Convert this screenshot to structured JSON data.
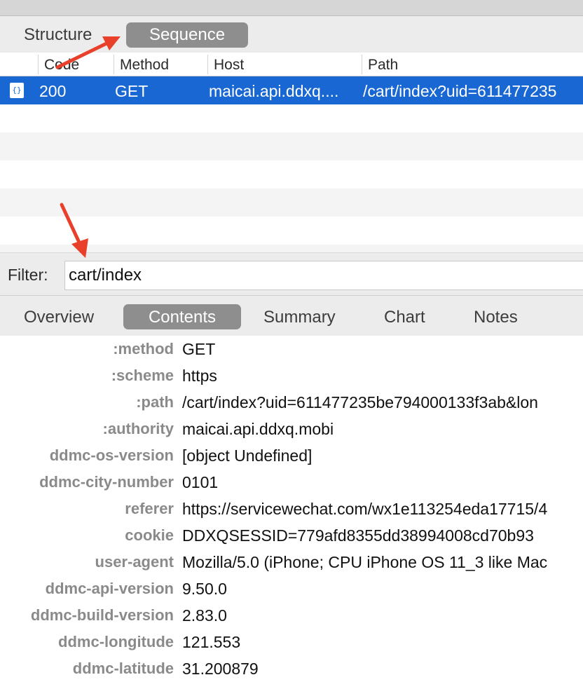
{
  "view_tabs": [
    "Structure",
    "Sequence"
  ],
  "columns": {
    "code": "Code",
    "method": "Method",
    "host": "Host",
    "path": "Path"
  },
  "selected_request": {
    "icon": "json-document-icon",
    "code": "200",
    "method": "GET",
    "host": "maicai.api.ddxq....",
    "path": "/cart/index?uid=611477235"
  },
  "filter": {
    "label": "Filter:",
    "value": "cart/index"
  },
  "detail_tabs": [
    "Overview",
    "Contents",
    "Summary",
    "Chart",
    "Notes"
  ],
  "headers": [
    {
      "key": ":method",
      "value": "GET"
    },
    {
      "key": ":scheme",
      "value": "https"
    },
    {
      "key": ":path",
      "value": "/cart/index?uid=611477235be794000133f3ab&lon"
    },
    {
      "key": ":authority",
      "value": "maicai.api.ddxq.mobi"
    },
    {
      "key": "ddmc-os-version",
      "value": "[object Undefined]"
    },
    {
      "key": "ddmc-city-number",
      "value": "0101"
    },
    {
      "key": "referer",
      "value": "https://servicewechat.com/wx1e113254eda17715/4"
    },
    {
      "key": "cookie",
      "value": "DDXQSESSID=779afd8355dd38994008cd70b93"
    },
    {
      "key": "user-agent",
      "value": "Mozilla/5.0 (iPhone; CPU iPhone OS 11_3 like Mac"
    },
    {
      "key": "ddmc-api-version",
      "value": "9.50.0"
    },
    {
      "key": "ddmc-build-version",
      "value": "2.83.0"
    },
    {
      "key": "ddmc-longitude",
      "value": "121.553"
    },
    {
      "key": "ddmc-latitude",
      "value": "31.200879"
    }
  ],
  "colors": {
    "selection": "#1967d2",
    "active_tab": "#8e8e8e",
    "annotation_arrow": "#e8402a"
  },
  "annotations": [
    "red-arrow-to-sequence-tab",
    "red-arrow-to-filter-input"
  ]
}
